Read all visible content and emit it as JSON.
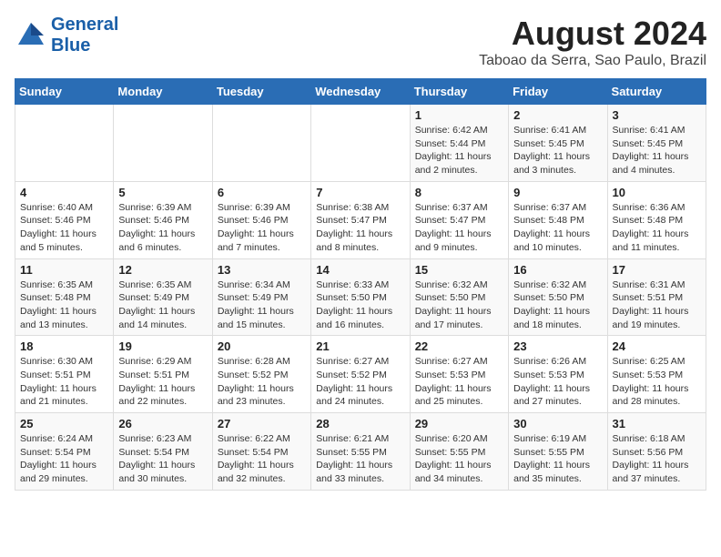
{
  "header": {
    "logo_line1": "General",
    "logo_line2": "Blue",
    "title": "August 2024",
    "subtitle": "Taboao da Serra, Sao Paulo, Brazil"
  },
  "days_of_week": [
    "Sunday",
    "Monday",
    "Tuesday",
    "Wednesday",
    "Thursday",
    "Friday",
    "Saturday"
  ],
  "weeks": [
    [
      {
        "day": "",
        "info": ""
      },
      {
        "day": "",
        "info": ""
      },
      {
        "day": "",
        "info": ""
      },
      {
        "day": "",
        "info": ""
      },
      {
        "day": "1",
        "info": "Sunrise: 6:42 AM\nSunset: 5:44 PM\nDaylight: 11 hours\nand 2 minutes."
      },
      {
        "day": "2",
        "info": "Sunrise: 6:41 AM\nSunset: 5:45 PM\nDaylight: 11 hours\nand 3 minutes."
      },
      {
        "day": "3",
        "info": "Sunrise: 6:41 AM\nSunset: 5:45 PM\nDaylight: 11 hours\nand 4 minutes."
      }
    ],
    [
      {
        "day": "4",
        "info": "Sunrise: 6:40 AM\nSunset: 5:46 PM\nDaylight: 11 hours\nand 5 minutes."
      },
      {
        "day": "5",
        "info": "Sunrise: 6:39 AM\nSunset: 5:46 PM\nDaylight: 11 hours\nand 6 minutes."
      },
      {
        "day": "6",
        "info": "Sunrise: 6:39 AM\nSunset: 5:46 PM\nDaylight: 11 hours\nand 7 minutes."
      },
      {
        "day": "7",
        "info": "Sunrise: 6:38 AM\nSunset: 5:47 PM\nDaylight: 11 hours\nand 8 minutes."
      },
      {
        "day": "8",
        "info": "Sunrise: 6:37 AM\nSunset: 5:47 PM\nDaylight: 11 hours\nand 9 minutes."
      },
      {
        "day": "9",
        "info": "Sunrise: 6:37 AM\nSunset: 5:48 PM\nDaylight: 11 hours\nand 10 minutes."
      },
      {
        "day": "10",
        "info": "Sunrise: 6:36 AM\nSunset: 5:48 PM\nDaylight: 11 hours\nand 11 minutes."
      }
    ],
    [
      {
        "day": "11",
        "info": "Sunrise: 6:35 AM\nSunset: 5:48 PM\nDaylight: 11 hours\nand 13 minutes."
      },
      {
        "day": "12",
        "info": "Sunrise: 6:35 AM\nSunset: 5:49 PM\nDaylight: 11 hours\nand 14 minutes."
      },
      {
        "day": "13",
        "info": "Sunrise: 6:34 AM\nSunset: 5:49 PM\nDaylight: 11 hours\nand 15 minutes."
      },
      {
        "day": "14",
        "info": "Sunrise: 6:33 AM\nSunset: 5:50 PM\nDaylight: 11 hours\nand 16 minutes."
      },
      {
        "day": "15",
        "info": "Sunrise: 6:32 AM\nSunset: 5:50 PM\nDaylight: 11 hours\nand 17 minutes."
      },
      {
        "day": "16",
        "info": "Sunrise: 6:32 AM\nSunset: 5:50 PM\nDaylight: 11 hours\nand 18 minutes."
      },
      {
        "day": "17",
        "info": "Sunrise: 6:31 AM\nSunset: 5:51 PM\nDaylight: 11 hours\nand 19 minutes."
      }
    ],
    [
      {
        "day": "18",
        "info": "Sunrise: 6:30 AM\nSunset: 5:51 PM\nDaylight: 11 hours\nand 21 minutes."
      },
      {
        "day": "19",
        "info": "Sunrise: 6:29 AM\nSunset: 5:51 PM\nDaylight: 11 hours\nand 22 minutes."
      },
      {
        "day": "20",
        "info": "Sunrise: 6:28 AM\nSunset: 5:52 PM\nDaylight: 11 hours\nand 23 minutes."
      },
      {
        "day": "21",
        "info": "Sunrise: 6:27 AM\nSunset: 5:52 PM\nDaylight: 11 hours\nand 24 minutes."
      },
      {
        "day": "22",
        "info": "Sunrise: 6:27 AM\nSunset: 5:53 PM\nDaylight: 11 hours\nand 25 minutes."
      },
      {
        "day": "23",
        "info": "Sunrise: 6:26 AM\nSunset: 5:53 PM\nDaylight: 11 hours\nand 27 minutes."
      },
      {
        "day": "24",
        "info": "Sunrise: 6:25 AM\nSunset: 5:53 PM\nDaylight: 11 hours\nand 28 minutes."
      }
    ],
    [
      {
        "day": "25",
        "info": "Sunrise: 6:24 AM\nSunset: 5:54 PM\nDaylight: 11 hours\nand 29 minutes."
      },
      {
        "day": "26",
        "info": "Sunrise: 6:23 AM\nSunset: 5:54 PM\nDaylight: 11 hours\nand 30 minutes."
      },
      {
        "day": "27",
        "info": "Sunrise: 6:22 AM\nSunset: 5:54 PM\nDaylight: 11 hours\nand 32 minutes."
      },
      {
        "day": "28",
        "info": "Sunrise: 6:21 AM\nSunset: 5:55 PM\nDaylight: 11 hours\nand 33 minutes."
      },
      {
        "day": "29",
        "info": "Sunrise: 6:20 AM\nSunset: 5:55 PM\nDaylight: 11 hours\nand 34 minutes."
      },
      {
        "day": "30",
        "info": "Sunrise: 6:19 AM\nSunset: 5:55 PM\nDaylight: 11 hours\nand 35 minutes."
      },
      {
        "day": "31",
        "info": "Sunrise: 6:18 AM\nSunset: 5:56 PM\nDaylight: 11 hours\nand 37 minutes."
      }
    ]
  ]
}
